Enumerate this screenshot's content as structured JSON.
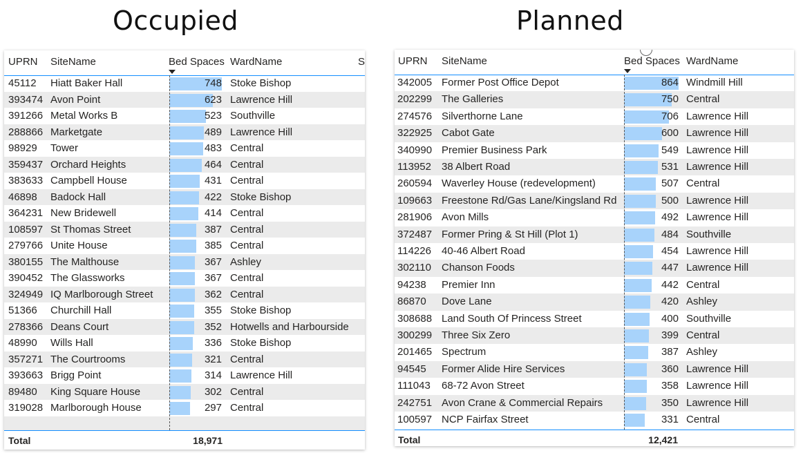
{
  "occupied": {
    "heading": "Occupied",
    "columns": [
      "UPRN",
      "SiteName",
      "Bed Spaces",
      "WardName",
      "S"
    ],
    "rows": [
      {
        "uprn": "45112",
        "site": "Hiatt Baker Hall",
        "beds": 748,
        "ward": "Stoke Bishop"
      },
      {
        "uprn": "393474",
        "site": "Avon Point",
        "beds": 623,
        "ward": "Lawrence Hill"
      },
      {
        "uprn": "391266",
        "site": "Metal Works B",
        "beds": 523,
        "ward": "Southville"
      },
      {
        "uprn": "288866",
        "site": "Marketgate",
        "beds": 489,
        "ward": "Lawrence Hill"
      },
      {
        "uprn": "98929",
        "site": "Tower",
        "beds": 483,
        "ward": "Central"
      },
      {
        "uprn": "359437",
        "site": "Orchard Heights",
        "beds": 464,
        "ward": "Central"
      },
      {
        "uprn": "383633",
        "site": "Campbell House",
        "beds": 431,
        "ward": "Central"
      },
      {
        "uprn": "46898",
        "site": "Badock Hall",
        "beds": 422,
        "ward": "Stoke Bishop"
      },
      {
        "uprn": "364231",
        "site": "New Bridewell",
        "beds": 414,
        "ward": "Central"
      },
      {
        "uprn": "108597",
        "site": "St Thomas Street",
        "beds": 387,
        "ward": "Central"
      },
      {
        "uprn": "279766",
        "site": "Unite House",
        "beds": 385,
        "ward": "Central"
      },
      {
        "uprn": "380155",
        "site": "The Malthouse",
        "beds": 367,
        "ward": "Ashley"
      },
      {
        "uprn": "390452",
        "site": "The Glassworks",
        "beds": 367,
        "ward": "Central"
      },
      {
        "uprn": "324949",
        "site": "IQ Marlborough Street",
        "beds": 362,
        "ward": "Central"
      },
      {
        "uprn": "51366",
        "site": "Churchill Hall",
        "beds": 355,
        "ward": "Stoke Bishop"
      },
      {
        "uprn": "278366",
        "site": "Deans Court",
        "beds": 352,
        "ward": "Hotwells and Harbourside"
      },
      {
        "uprn": "48990",
        "site": "Wills Hall",
        "beds": 336,
        "ward": "Stoke Bishop"
      },
      {
        "uprn": "357271",
        "site": "The Courtrooms",
        "beds": 321,
        "ward": "Central"
      },
      {
        "uprn": "393663",
        "site": "Brigg Point",
        "beds": 314,
        "ward": "Lawrence Hill"
      },
      {
        "uprn": "89480",
        "site": "King Square House",
        "beds": 302,
        "ward": "Central"
      },
      {
        "uprn": "319028",
        "site": "Marlborough House",
        "beds": 297,
        "ward": "Central"
      }
    ],
    "total_label": "Total",
    "total_value": "18,971"
  },
  "planned": {
    "heading": "Planned",
    "columns": [
      "UPRN",
      "SiteName",
      "Bed Spaces",
      "WardName"
    ],
    "rows": [
      {
        "uprn": "342005",
        "site": "Former Post Office Depot",
        "beds": 864,
        "ward": "Windmill Hill"
      },
      {
        "uprn": "202299",
        "site": "The Galleries",
        "beds": 750,
        "ward": "Central"
      },
      {
        "uprn": "274576",
        "site": "Silverthorne Lane",
        "beds": 706,
        "ward": "Lawrence Hill"
      },
      {
        "uprn": "322925",
        "site": "Cabot Gate",
        "beds": 600,
        "ward": "Lawrence Hill"
      },
      {
        "uprn": "340990",
        "site": "Premier Business Park",
        "beds": 549,
        "ward": "Lawrence Hill"
      },
      {
        "uprn": "113952",
        "site": "38 Albert Road",
        "beds": 531,
        "ward": "Lawrence Hill"
      },
      {
        "uprn": "260594",
        "site": "Waverley House (redevelopment)",
        "beds": 507,
        "ward": "Central"
      },
      {
        "uprn": "109663",
        "site": "Freestone Rd/Gas Lane/Kingsland Rd",
        "beds": 500,
        "ward": "Lawrence Hill"
      },
      {
        "uprn": "281906",
        "site": "Avon Mills",
        "beds": 492,
        "ward": "Lawrence Hill"
      },
      {
        "uprn": "372487",
        "site": "Former Pring & St Hill (Plot 1)",
        "beds": 484,
        "ward": "Southville"
      },
      {
        "uprn": "114226",
        "site": "40-46 Albert Road",
        "beds": 454,
        "ward": "Lawrence Hill"
      },
      {
        "uprn": "302110",
        "site": "Chanson Foods",
        "beds": 447,
        "ward": "Lawrence Hill"
      },
      {
        "uprn": "94238",
        "site": "Premier Inn",
        "beds": 442,
        "ward": "Central"
      },
      {
        "uprn": "86870",
        "site": "Dove Lane",
        "beds": 420,
        "ward": "Ashley"
      },
      {
        "uprn": "308688",
        "site": "Land South Of Princess Street",
        "beds": 400,
        "ward": "Southville"
      },
      {
        "uprn": "300299",
        "site": "Three Six Zero",
        "beds": 399,
        "ward": "Central"
      },
      {
        "uprn": "201465",
        "site": "Spectrum",
        "beds": 387,
        "ward": "Ashley"
      },
      {
        "uprn": "94545",
        "site": "Former Alide Hire Services",
        "beds": 360,
        "ward": "Lawrence Hill"
      },
      {
        "uprn": "111043",
        "site": "68-72 Avon Street",
        "beds": 358,
        "ward": "Lawrence Hill"
      },
      {
        "uprn": "242751",
        "site": "Avon Crane & Commercial Repairs",
        "beds": 350,
        "ward": "Lawrence Hill"
      },
      {
        "uprn": "100597",
        "site": "NCP Fairfax Street",
        "beds": 331,
        "ward": "Central"
      }
    ],
    "total_label": "Total",
    "total_value": "12,421"
  },
  "colors": {
    "bar": "#a8d3fb",
    "accent": "#118dff",
    "alt_row": "#ebebeb"
  }
}
